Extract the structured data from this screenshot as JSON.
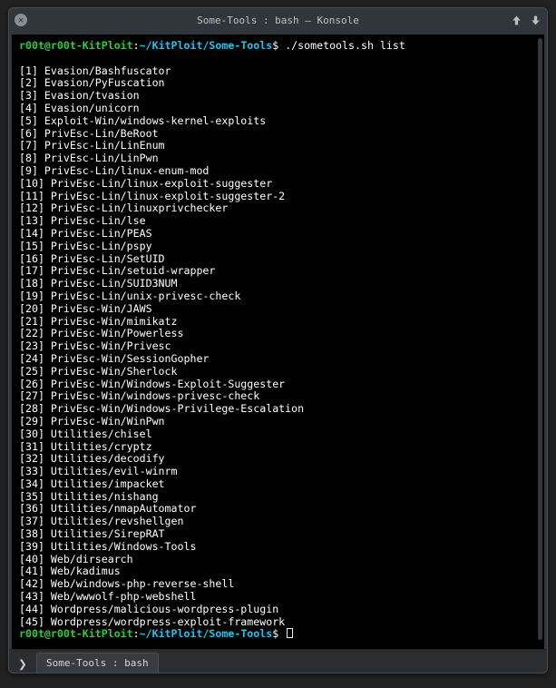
{
  "window": {
    "title": "Some-Tools : bash — Konsole"
  },
  "prompt": {
    "user": "r00t",
    "at": "@",
    "host": "r00t-KitPloit",
    "colon": ":",
    "path": "~/KitPloit/Some-Tools",
    "dollar": "$",
    "command": "./sometools.sh list"
  },
  "list": [
    {
      "n": "1",
      "t": "Evasion/Bashfuscator"
    },
    {
      "n": "2",
      "t": "Evasion/PyFuscation"
    },
    {
      "n": "3",
      "t": "Evasion/tvasion"
    },
    {
      "n": "4",
      "t": "Evasion/unicorn"
    },
    {
      "n": "5",
      "t": "Exploit-Win/windows-kernel-exploits"
    },
    {
      "n": "6",
      "t": "PrivEsc-Lin/BeRoot"
    },
    {
      "n": "7",
      "t": "PrivEsc-Lin/LinEnum"
    },
    {
      "n": "8",
      "t": "PrivEsc-Lin/LinPwn"
    },
    {
      "n": "9",
      "t": "PrivEsc-Lin/linux-enum-mod"
    },
    {
      "n": "10",
      "t": "PrivEsc-Lin/linux-exploit-suggester"
    },
    {
      "n": "11",
      "t": "PrivEsc-Lin/linux-exploit-suggester-2"
    },
    {
      "n": "12",
      "t": "PrivEsc-Lin/linuxprivchecker"
    },
    {
      "n": "13",
      "t": "PrivEsc-Lin/lse"
    },
    {
      "n": "14",
      "t": "PrivEsc-Lin/PEAS"
    },
    {
      "n": "15",
      "t": "PrivEsc-Lin/pspy"
    },
    {
      "n": "16",
      "t": "PrivEsc-Lin/SetUID"
    },
    {
      "n": "17",
      "t": "PrivEsc-Lin/setuid-wrapper"
    },
    {
      "n": "18",
      "t": "PrivEsc-Lin/SUID3NUM"
    },
    {
      "n": "19",
      "t": "PrivEsc-Lin/unix-privesc-check"
    },
    {
      "n": "20",
      "t": "PrivEsc-Win/JAWS"
    },
    {
      "n": "21",
      "t": "PrivEsc-Win/mimikatz"
    },
    {
      "n": "22",
      "t": "PrivEsc-Win/Powerless"
    },
    {
      "n": "23",
      "t": "PrivEsc-Win/Privesc"
    },
    {
      "n": "24",
      "t": "PrivEsc-Win/SessionGopher"
    },
    {
      "n": "25",
      "t": "PrivEsc-Win/Sherlock"
    },
    {
      "n": "26",
      "t": "PrivEsc-Win/Windows-Exploit-Suggester"
    },
    {
      "n": "27",
      "t": "PrivEsc-Win/windows-privesc-check"
    },
    {
      "n": "28",
      "t": "PrivEsc-Win/Windows-Privilege-Escalation"
    },
    {
      "n": "29",
      "t": "PrivEsc-Win/WinPwn"
    },
    {
      "n": "30",
      "t": "Utilities/chisel"
    },
    {
      "n": "31",
      "t": "Utilities/cryptz"
    },
    {
      "n": "32",
      "t": "Utilities/decodify"
    },
    {
      "n": "33",
      "t": "Utilities/evil-winrm"
    },
    {
      "n": "34",
      "t": "Utilities/impacket"
    },
    {
      "n": "35",
      "t": "Utilities/nishang"
    },
    {
      "n": "36",
      "t": "Utilities/nmapAutomator"
    },
    {
      "n": "37",
      "t": "Utilities/revshellgen"
    },
    {
      "n": "38",
      "t": "Utilities/SirepRAT"
    },
    {
      "n": "39",
      "t": "Utilities/Windows-Tools"
    },
    {
      "n": "40",
      "t": "Web/dirsearch"
    },
    {
      "n": "41",
      "t": "Web/kadimus"
    },
    {
      "n": "42",
      "t": "Web/windows-php-reverse-shell"
    },
    {
      "n": "43",
      "t": "Web/wwwolf-php-webshell"
    },
    {
      "n": "44",
      "t": "Wordpress/malicious-wordpress-plugin"
    },
    {
      "n": "45",
      "t": "Wordpress/wordpress-exploit-framework"
    }
  ],
  "tab": {
    "label": "Some-Tools : bash"
  },
  "icons": {
    "close_glyph": "✕",
    "new_tab_glyph": "❯"
  }
}
